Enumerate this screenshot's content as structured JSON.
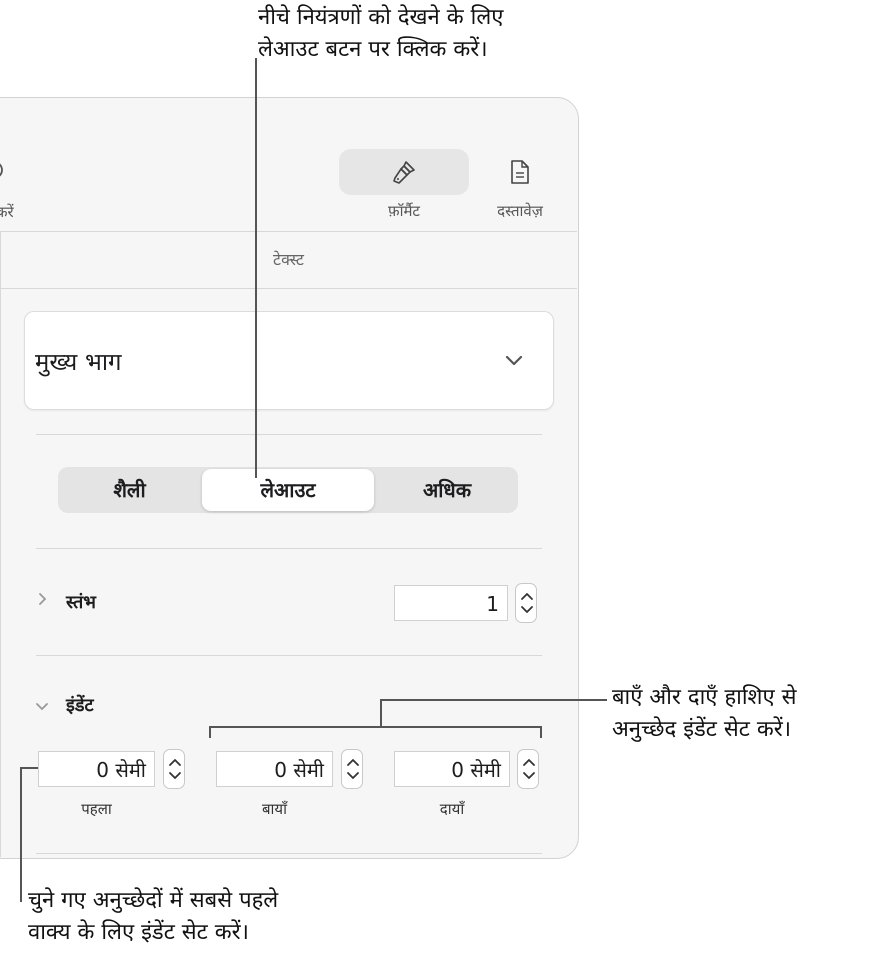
{
  "callouts": {
    "top_line1": "नीचे नियंत्रणों को देखने के लिए",
    "top_line2": "लेआउट बटन पर क्लिक करें।",
    "right_line1": "बाएँ और दाएँ हाशिए से",
    "right_line2": "अनुच्छेद इंडेंट सेट करें।",
    "bottom_line1": "चुने गए अनुच्छेदों में सबसे पहले",
    "bottom_line2": "वाक्य के लिए इंडेंट सेट करें।"
  },
  "toolbar": {
    "partial_label": "करें",
    "format_label": "फ़ॉर्मैट",
    "document_label": "दस्तावेज़",
    "format_icon": "paintbrush-icon",
    "document_icon": "document-icon"
  },
  "inspector": {
    "section_title": "टेक्स्ट",
    "paragraph_style": "मुख्य भाग",
    "tabs": [
      {
        "label": "शैली",
        "active": false
      },
      {
        "label": "लेआउट",
        "active": true
      },
      {
        "label": "अधिक",
        "active": false
      }
    ],
    "columns": {
      "label": "स्तंभ",
      "value": "1"
    },
    "indents": {
      "label": "इंडेंट",
      "first": {
        "value": "0 सेमी",
        "label": "पहला"
      },
      "left": {
        "value": "0 सेमी",
        "label": "बायाँ"
      },
      "right": {
        "value": "0 सेमी",
        "label": "दायाँ"
      }
    }
  }
}
